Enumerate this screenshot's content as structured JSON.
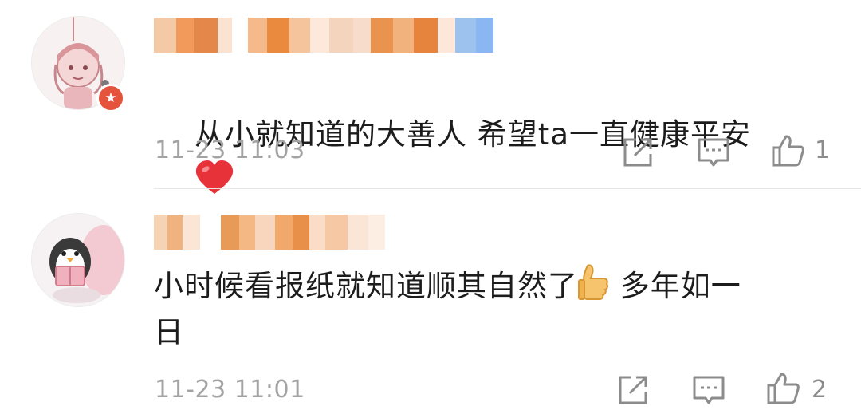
{
  "comments": [
    {
      "text": "从小就知道的大善人 希望ta一直健康平安",
      "emoji": "heart-emoji",
      "time": "11-23 11:03",
      "likes": "1",
      "avatar_icon": "girl-avatar-icon",
      "has_badge": true
    },
    {
      "text_a": "小时候看报纸就知道顺其自然了",
      "emoji": "thumbs-up-emoji",
      "text_b": " 多年如一\n日",
      "time": "11-23 11:01",
      "likes": "2",
      "avatar_icon": "penguin-reading-avatar-icon",
      "has_badge": false
    }
  ],
  "colors": {
    "accent_badge": "#e5533c",
    "timestamp": "#a3a3a3",
    "heart": "#e8323a"
  }
}
